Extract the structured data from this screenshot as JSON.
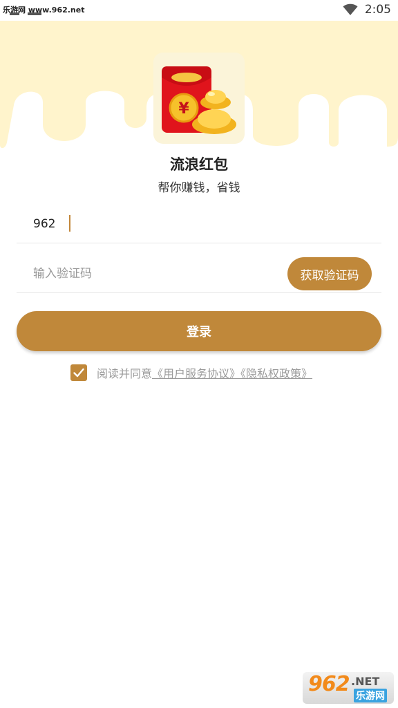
{
  "status_bar": {
    "watermark": "乐游网 www.962.net",
    "time": "2:05",
    "wifi_icon": "wifi-icon"
  },
  "app": {
    "name": "流浪红包",
    "slogan": "帮你赚钱，省钱",
    "logo_icon": "red-envelope-gold-ingot-icon"
  },
  "form": {
    "phone_value": "962",
    "code_placeholder": "输入验证码",
    "get_code_label": "获取验证码",
    "login_label": "登录"
  },
  "agreement": {
    "checked": true,
    "text": "阅读并同意",
    "links_text": "《用户服务协议》《隐私权政策》"
  },
  "watermark_bottom": {
    "number": "962",
    "net": ".NET",
    "cn": "乐游网"
  },
  "colors": {
    "accent": "#c0883a",
    "header_bg": "#fff4cc",
    "logo_bg": "#fbf4d9"
  }
}
